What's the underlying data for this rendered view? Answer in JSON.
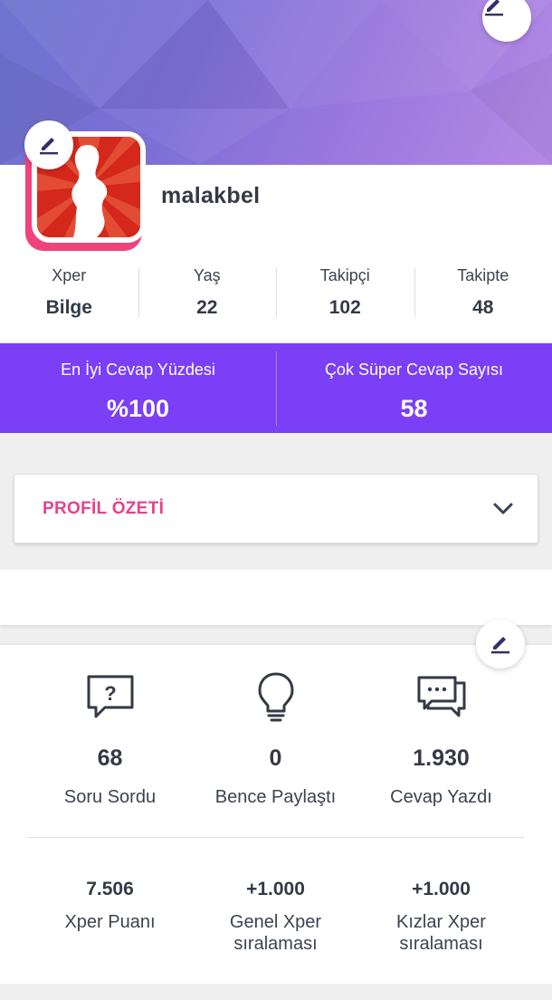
{
  "colors": {
    "accent_purple": "#7a3ff6",
    "pink": "#e6418c",
    "avatar_back": "#f0427b",
    "text_dark": "#333a45"
  },
  "icons": {
    "cover_edit": "pencil-icon",
    "avatar_edit": "pencil-icon",
    "activity_edit": "pencil-icon",
    "summary_toggle": "chevron-down-icon",
    "question": "question-bubble-icon",
    "idea": "lightbulb-icon",
    "answer": "chat-bubbles-icon"
  },
  "profile": {
    "username": "malakbel",
    "stats": [
      {
        "label": "Xper",
        "value": "Bilge"
      },
      {
        "label": "Yaş",
        "value": "22"
      },
      {
        "label": "Takipçi",
        "value": "102"
      },
      {
        "label": "Takipte",
        "value": "48"
      }
    ]
  },
  "highlights": [
    {
      "label": "En İyi Cevap Yüzdesi",
      "value": "%100"
    },
    {
      "label": "Çok Süper Cevap Sayısı",
      "value": "58"
    }
  ],
  "summary": {
    "title": "PROFİL ÖZETİ"
  },
  "activity": [
    {
      "value": "68",
      "label": "Soru Sordu"
    },
    {
      "value": "0",
      "label": "Bence Paylaştı"
    },
    {
      "value": "1.930",
      "label": "Cevap Yazdı"
    }
  ],
  "ranking": [
    {
      "value": "7.506",
      "label_line1": "Xper Puanı",
      "label_line2": ""
    },
    {
      "value": "+1.000",
      "label_line1": "Genel Xper",
      "label_line2": "sıralaması"
    },
    {
      "value": "+1.000",
      "label_line1": "Kızlar Xper",
      "label_line2": "sıralaması"
    }
  ]
}
